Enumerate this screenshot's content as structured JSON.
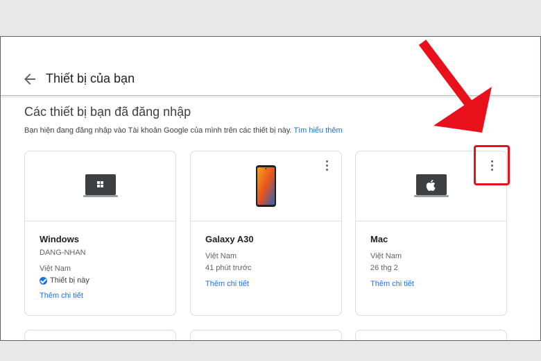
{
  "header": {
    "title": "Thiết bị của bạn"
  },
  "section": {
    "title": "Các thiết bị bạn đã đăng nhập",
    "description": "Bạn hiện đang đăng nhập vào Tài khoản Google của mình trên các thiết bị này.",
    "learn_more": "Tìm hiểu thêm"
  },
  "devices": [
    {
      "name": "Windows",
      "host": "DANG-NHAN",
      "location": "Việt Nam",
      "status": "Thiết bị này",
      "details_link": "Thêm chi tiết",
      "icon": "windows-laptop-icon"
    },
    {
      "name": "Galaxy A30",
      "location": "Việt Nam",
      "last_seen": "41 phút trước",
      "details_link": "Thêm chi tiết",
      "icon": "android-phone-icon"
    },
    {
      "name": "Mac",
      "location": "Việt Nam",
      "last_seen": "26 thg 2",
      "details_link": "Thêm chi tiết",
      "icon": "mac-laptop-icon"
    }
  ],
  "colors": {
    "accent": "#1a73e8",
    "annotation": "#e8111b",
    "border": "#dadce0"
  }
}
